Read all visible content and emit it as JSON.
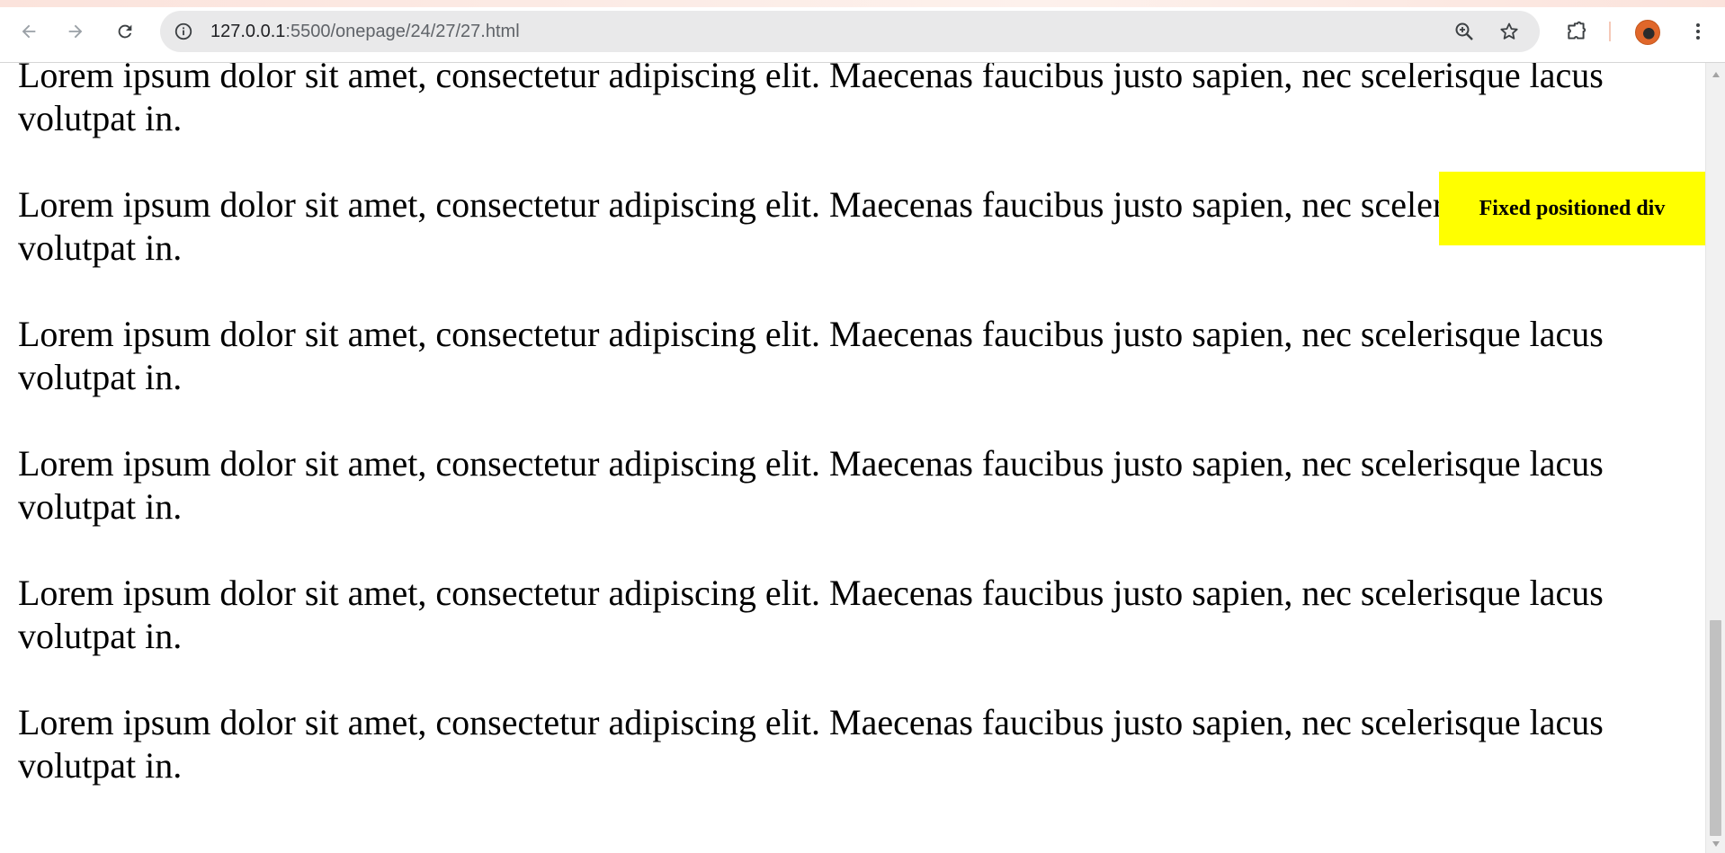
{
  "browser": {
    "url_host": "127.0.0.1",
    "url_rest": ":5500/onepage/24/27/27.html",
    "icons": {
      "back": "arrow-left-icon",
      "forward": "arrow-right-icon",
      "reload": "reload-icon",
      "site_info": "info-icon",
      "zoom": "zoom-icon",
      "bookmark": "star-icon",
      "extensions": "puzzle-icon",
      "profile": "avatar",
      "menu": "kebab-menu-icon"
    }
  },
  "page": {
    "paragraphs": [
      "Lorem ipsum dolor sit amet, consectetur adipiscing elit. Maecenas faucibus justo sapien, nec scelerisque lacus volutpat in.",
      "Lorem ipsum dolor sit amet, consectetur adipiscing elit. Maecenas faucibus justo sapien, nec scelerisque lacus volutpat in.",
      "Lorem ipsum dolor sit amet, consectetur adipiscing elit. Maecenas faucibus justo sapien, nec scelerisque lacus volutpat in.",
      "Lorem ipsum dolor sit amet, consectetur adipiscing elit. Maecenas faucibus justo sapien, nec scelerisque lacus volutpat in.",
      "Lorem ipsum dolor sit amet, consectetur adipiscing elit. Maecenas faucibus justo sapien, nec scelerisque lacus volutpat in.",
      "Lorem ipsum dolor sit amet, consectetur adipiscing elit. Maecenas faucibus justo sapien, nec scelerisque lacus volutpat in."
    ],
    "fixed_div_label": "Fixed positioned div",
    "fixed_div_color": "#ffff00"
  }
}
